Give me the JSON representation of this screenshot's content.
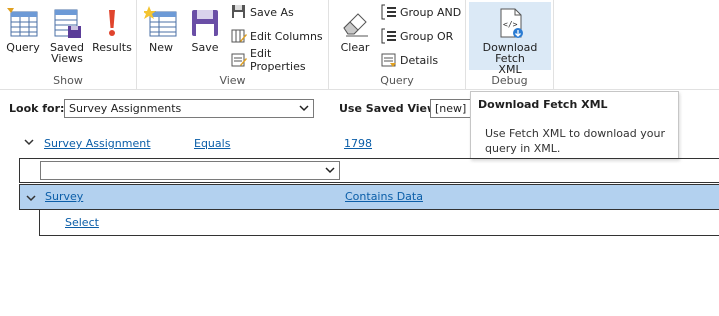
{
  "ribbon": {
    "groups": {
      "show": "Show",
      "view": "View",
      "query": "Query",
      "debug": "Debug"
    },
    "buttons": {
      "query": "Query",
      "saved_views_1": "Saved",
      "saved_views_2": "Views",
      "results": "Results",
      "new": "New",
      "save": "Save",
      "save_as": "Save As",
      "edit_columns": "Edit Columns",
      "edit_properties": "Edit Properties",
      "clear": "Clear",
      "group_and": "Group AND",
      "group_or": "Group OR",
      "details": "Details",
      "download_fetch_1": "Download Fetch",
      "download_fetch_2": "XML"
    }
  },
  "form": {
    "look_for_label": "Look for:",
    "look_for_value": "Survey Assignments",
    "saved_view_label": "Use Saved View:",
    "saved_view_value": "[new]"
  },
  "tooltip": {
    "title": "Download Fetch XML",
    "body": "Use Fetch XML to download your query in XML."
  },
  "criteria": {
    "row1": {
      "field": "Survey Assignment",
      "operator": "Equals",
      "value": "1798"
    },
    "row2": {
      "field": "Survey",
      "operator": "Contains Data"
    },
    "select_link": "Select"
  },
  "colors": {
    "link": "#0b5ea8",
    "highlight_row": "#b3d1ef",
    "debug_active": "#dbe9f6"
  }
}
